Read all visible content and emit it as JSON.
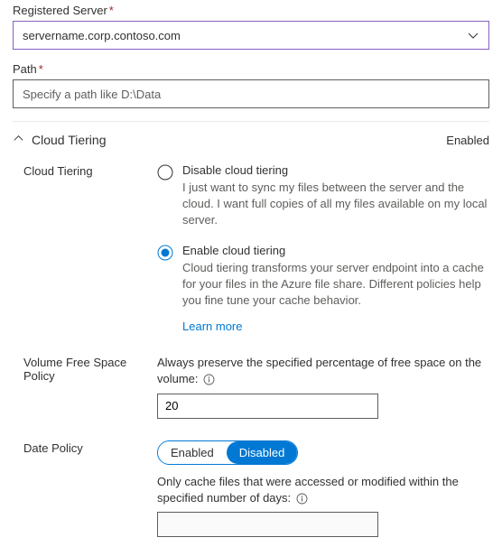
{
  "registeredServer": {
    "label": "Registered Server",
    "value": "servername.corp.contoso.com"
  },
  "path": {
    "label": "Path",
    "placeholder": "Specify a path like D:\\Data",
    "value": ""
  },
  "cloudTiering": {
    "sectionTitle": "Cloud Tiering",
    "status": "Enabled",
    "fieldLabel": "Cloud Tiering",
    "disableOption": {
      "label": "Disable cloud tiering",
      "desc": "I just want to sync my files between the server and the cloud. I want full copies of all my files available on my local server."
    },
    "enableOption": {
      "label": "Enable cloud tiering",
      "desc": "Cloud tiering transforms your server endpoint into a cache for your files in the Azure file share. Different policies help you fine tune your cache behavior."
    },
    "learnMore": "Learn more"
  },
  "volumePolicy": {
    "label": "Volume Free Space Policy",
    "desc": "Always preserve the specified percentage of free space on the volume:",
    "value": "20"
  },
  "datePolicy": {
    "label": "Date Policy",
    "toggle": {
      "enabled": "Enabled",
      "disabled": "Disabled"
    },
    "desc": "Only cache files that were accessed or modified within the specified number of days:",
    "value": ""
  }
}
